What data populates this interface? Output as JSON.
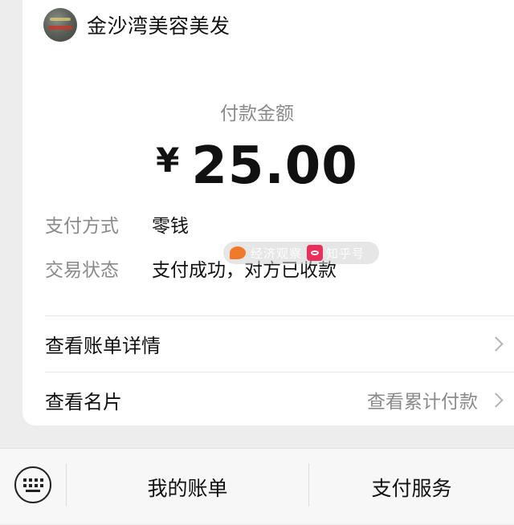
{
  "merchant": {
    "name": "金沙湾美容美发"
  },
  "payment": {
    "amount_label": "付款金额",
    "currency_symbol": "¥",
    "amount": "25.00"
  },
  "details": [
    {
      "key": "支付方式",
      "value": "零钱"
    },
    {
      "key": "交易状态",
      "value": "支付成功，对方已收款"
    }
  ],
  "watermark": {
    "text1": "经济观察",
    "text2": "知乎号"
  },
  "menu": [
    {
      "label": "查看账单详情",
      "extra": ""
    },
    {
      "label": "查看名片",
      "extra": "查看累计付款"
    }
  ],
  "bottom_bar": {
    "keyboard_icon": "keyboard-icon",
    "items": [
      {
        "label": "我的账单"
      },
      {
        "label": "支付服务"
      }
    ]
  },
  "colors": {
    "background": "#ededed",
    "card": "#ffffff",
    "muted_text": "#8a8a8a"
  }
}
